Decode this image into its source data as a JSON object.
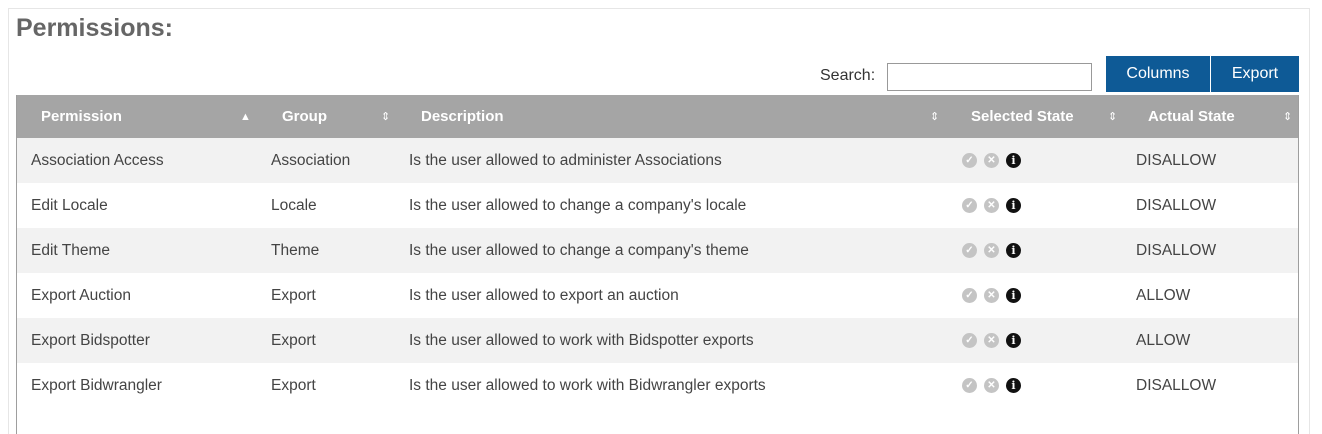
{
  "header": {
    "title": "Permissions:"
  },
  "toolbar": {
    "search_label": "Search:",
    "search_value": "",
    "columns_label": "Columns",
    "export_label": "Export"
  },
  "table": {
    "columns": [
      {
        "label": "Permission",
        "sort": "ascending"
      },
      {
        "label": "Group",
        "sort": "none"
      },
      {
        "label": "Description",
        "sort": "none"
      },
      {
        "label": "Selected State",
        "sort": "none"
      },
      {
        "label": "Actual State",
        "sort": "none"
      }
    ],
    "sort_icons": {
      "ascending": "▲",
      "none": "⇕"
    },
    "state_icons": [
      "check-circle-icon",
      "x-circle-icon",
      "info-circle-icon"
    ],
    "rows": [
      {
        "permission": "Association Access",
        "group": "Association",
        "description": "Is the user allowed to administer Associations",
        "actual": "DISALLOW"
      },
      {
        "permission": "Edit Locale",
        "group": "Locale",
        "description": "Is the user allowed to change a company's locale",
        "actual": "DISALLOW"
      },
      {
        "permission": "Edit Theme",
        "group": "Theme",
        "description": "Is the user allowed to change a company's theme",
        "actual": "DISALLOW"
      },
      {
        "permission": "Export Auction",
        "group": "Export",
        "description": "Is the user allowed to export an auction",
        "actual": "ALLOW"
      },
      {
        "permission": "Export Bidspotter",
        "group": "Export",
        "description": "Is the user allowed to work with Bidspotter exports",
        "actual": "ALLOW"
      },
      {
        "permission": "Export Bidwrangler",
        "group": "Export",
        "description": "Is the user allowed to work with Bidwrangler exports",
        "actual": "DISALLOW"
      }
    ]
  },
  "colors": {
    "header_bg": "#a5a5a5",
    "button_bg": "#0e5a96",
    "alt_row_bg": "#f2f2f2"
  }
}
